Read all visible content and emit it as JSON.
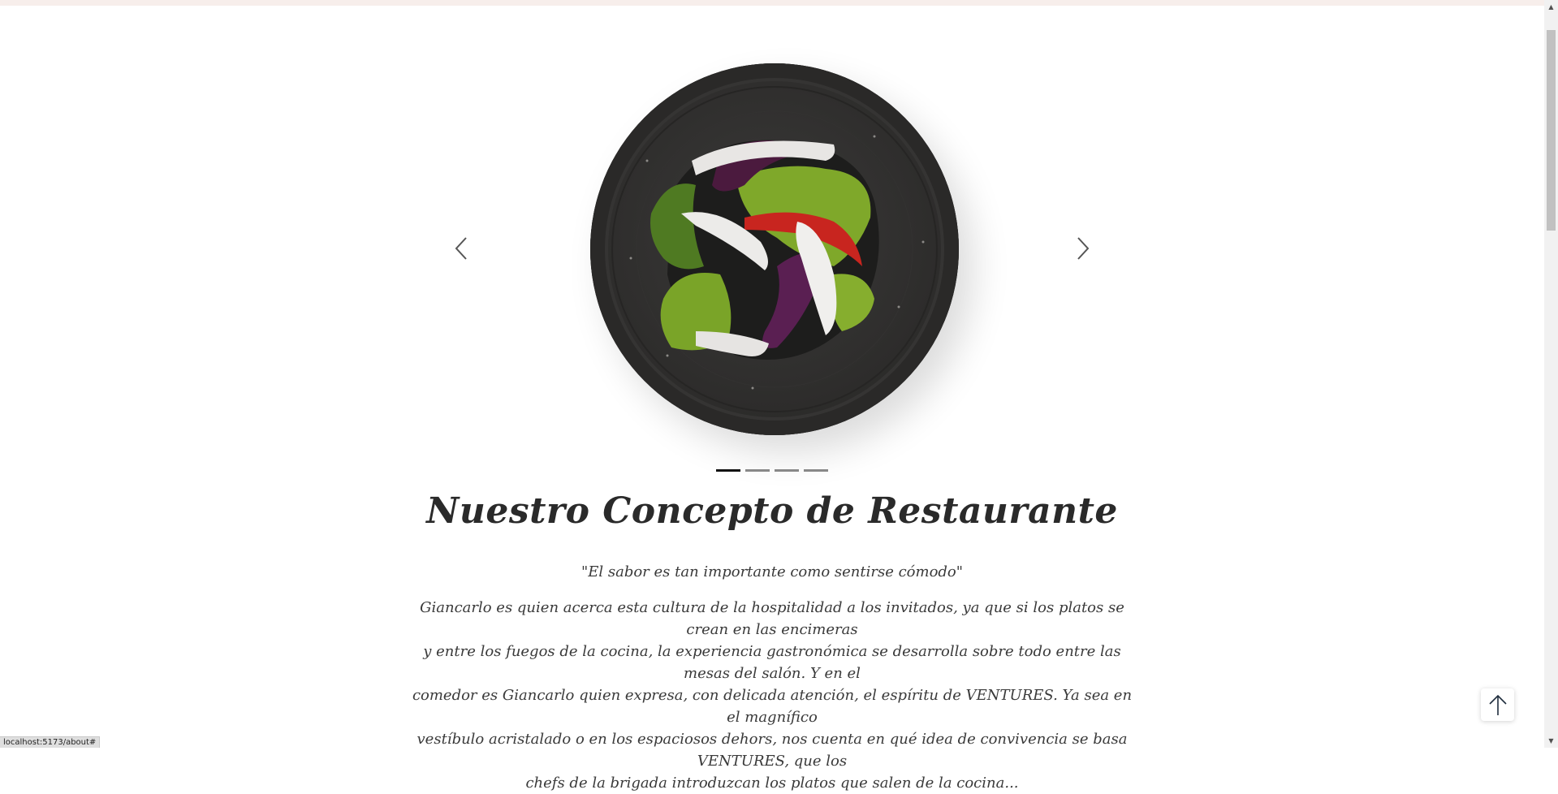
{
  "page": {
    "status_url": "localhost:5173/about#"
  },
  "carousel": {
    "prev_icon": "chevron-left-icon",
    "next_icon": "chevron-right-icon",
    "slide_count": 4,
    "active_slide": 1,
    "image_alt": "dish-photo"
  },
  "concept": {
    "title": "Nuestro Concepto de Restaurante",
    "quote": "\"El sabor es tan importante como sentirse cómodo\"",
    "paragraph_lines": [
      "Giancarlo es quien acerca esta cultura de la hospitalidad a los invitados, ya que si los platos se crean en las encimeras",
      "y entre los fuegos de la cocina, la experiencia gastronómica se desarrolla sobre todo entre las mesas del salón. Y en el",
      "comedor es Giancarlo quien expresa, con delicada atención, el espíritu de VENTURES. Ya sea en el magnífico",
      "vestíbulo acristalado o en los espaciosos dehors, nos cuenta en qué idea de convivencia se basa VENTURES, que los",
      "chefs de la brigada introduzcan los platos que salen de la cocina..."
    ]
  },
  "scroll_top": {
    "icon": "arrow-up-icon"
  },
  "colors": {
    "top_strip": "#f7eeeb",
    "text": "#3a3a3a",
    "plate": "#2f2e2d",
    "indicator_active": "#111111",
    "indicator_inactive": "#888888"
  }
}
